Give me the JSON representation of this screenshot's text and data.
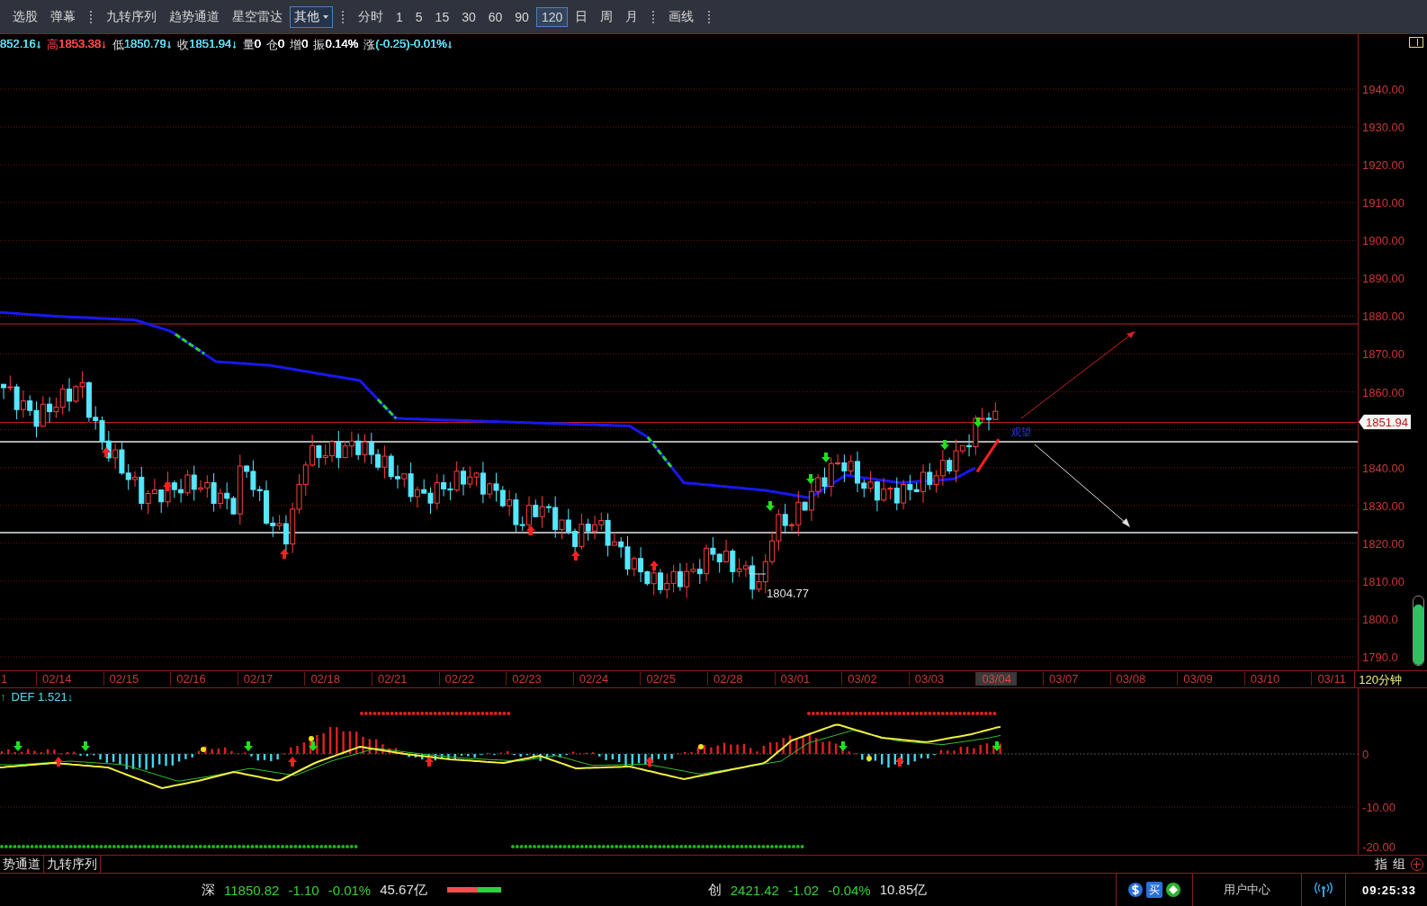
{
  "toolbar": {
    "items": [
      {
        "kind": "button",
        "label": "选股",
        "selected": false
      },
      {
        "kind": "button",
        "label": "弹幕",
        "selected": false
      },
      {
        "kind": "separator"
      },
      {
        "kind": "button",
        "label": "九转序列",
        "selected": false
      },
      {
        "kind": "button",
        "label": "趋势通道",
        "selected": false
      },
      {
        "kind": "button",
        "label": "星空雷达",
        "selected": false
      },
      {
        "kind": "dropdown",
        "label": "其他",
        "selected": false
      },
      {
        "kind": "separator"
      },
      {
        "kind": "button",
        "label": "分时",
        "selected": false
      },
      {
        "kind": "button",
        "label": "1",
        "selected": false
      },
      {
        "kind": "button",
        "label": "5",
        "selected": false
      },
      {
        "kind": "button",
        "label": "15",
        "selected": false
      },
      {
        "kind": "button",
        "label": "30",
        "selected": false
      },
      {
        "kind": "button",
        "label": "60",
        "selected": false
      },
      {
        "kind": "button",
        "label": "90",
        "selected": false
      },
      {
        "kind": "button",
        "label": "120",
        "selected": true
      },
      {
        "kind": "button",
        "label": "日",
        "selected": false
      },
      {
        "kind": "button",
        "label": "周",
        "selected": false
      },
      {
        "kind": "button",
        "label": "月",
        "selected": false
      },
      {
        "kind": "separator"
      },
      {
        "kind": "button",
        "label": "画线",
        "selected": false
      },
      {
        "kind": "separator"
      }
    ]
  },
  "quote": [
    {
      "value": "852.16↓",
      "color": "#5fd8f0"
    },
    {
      "label": "高",
      "value": "1853.38↓",
      "color": "#ff4a4a"
    },
    {
      "label": "低",
      "value": "1850.79↓",
      "color": "#5fd8f0"
    },
    {
      "label": "收",
      "value": "1851.94↓",
      "color": "#5fd8f0"
    },
    {
      "label": "量",
      "value": "0",
      "color": "#ffffff"
    },
    {
      "label": "仓",
      "value": "0",
      "color": "#ffffff"
    },
    {
      "label": "增",
      "value": "0",
      "color": "#ffffff"
    },
    {
      "label": "振",
      "value": "0.14%",
      "color": "#ffffff"
    },
    {
      "label": "涨",
      "value": "(-0.25)-0.01%↓",
      "color": "#5fd8f0"
    }
  ],
  "zoom_meter": {
    "level": 0.88
  },
  "price_chart": {
    "low_label": "1804.77",
    "signal_label": "观望",
    "last_price": "1851.94",
    "price_axis": [
      "1940.00",
      "1930.00",
      "1920.00",
      "1910.00",
      "1900.00",
      "1890.00",
      "1880.00",
      "1870.00",
      "1860.00",
      "1840.00",
      "1830.00",
      "1820.00",
      "1810.00",
      "1800.0",
      "1790.0"
    ]
  },
  "x_axis": {
    "dates": [
      {
        "label": "1",
        "selected": false
      },
      {
        "label": "02/14",
        "selected": false
      },
      {
        "label": "02/15",
        "selected": false
      },
      {
        "label": "02/16",
        "selected": false
      },
      {
        "label": "02/17",
        "selected": false
      },
      {
        "label": "02/18",
        "selected": false
      },
      {
        "label": "02/21",
        "selected": false
      },
      {
        "label": "02/22",
        "selected": false
      },
      {
        "label": "02/23",
        "selected": false
      },
      {
        "label": "02/24",
        "selected": false
      },
      {
        "label": "02/25",
        "selected": false
      },
      {
        "label": "02/28",
        "selected": false
      },
      {
        "label": "03/01",
        "selected": false
      },
      {
        "label": "03/02",
        "selected": false
      },
      {
        "label": "03/03",
        "selected": false
      },
      {
        "label": "03/04",
        "selected": true
      },
      {
        "label": "03/07",
        "selected": false
      },
      {
        "label": "03/08",
        "selected": false
      },
      {
        "label": "03/09",
        "selected": false
      },
      {
        "label": "03/10",
        "selected": false
      },
      {
        "label": "03/11",
        "selected": false
      }
    ],
    "period": "120分钟"
  },
  "indicator": {
    "arrow": "↑",
    "title": "DEF 1.521↓",
    "axis": [
      "0",
      "-10.00",
      "-20.00"
    ]
  },
  "bottom_tabs": [
    "势通道",
    "九转序列"
  ],
  "panel_buttons": [
    "指",
    "组"
  ],
  "status_bar": {
    "indices": [
      {
        "name": "深",
        "value": "11850.82",
        "change": "-1.10",
        "percent": "-0.01%",
        "volume": "45.67亿"
      },
      {
        "name": "创",
        "value": "2421.42",
        "change": "-1.02",
        "percent": "-0.04%",
        "volume": "10.85亿"
      }
    ],
    "breadth": {
      "level": 0.57
    },
    "buy_badge": "买",
    "user_center": "用户中心",
    "time": "09:25:33"
  }
}
